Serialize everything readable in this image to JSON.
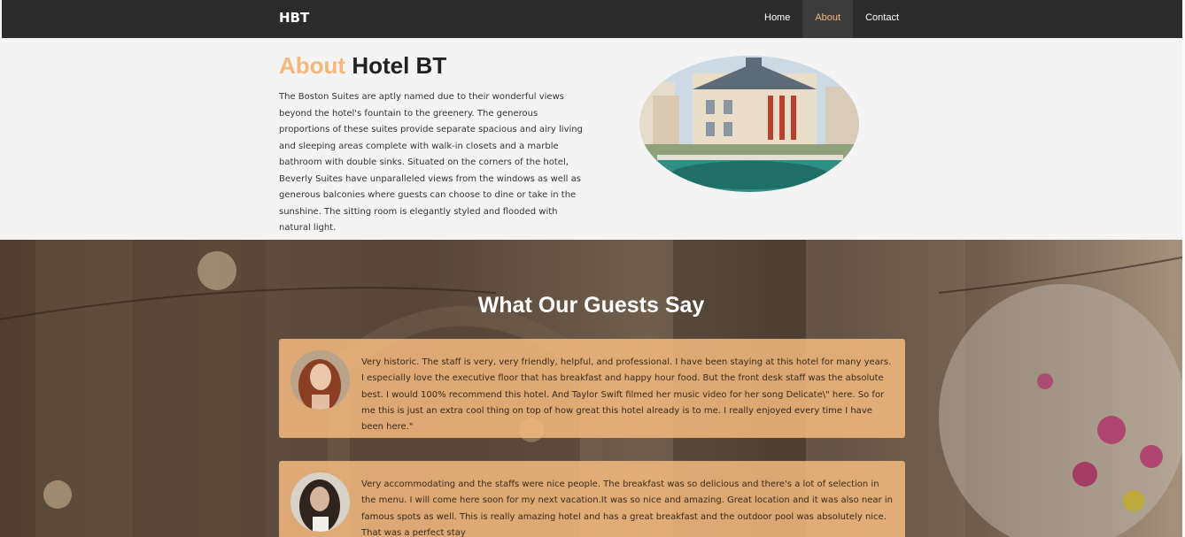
{
  "nav": {
    "brand": "HBT",
    "links": [
      "Home",
      "About",
      "Contact"
    ],
    "active": "About",
    "accent_color": "#f4b77e"
  },
  "about": {
    "title_accent": "About",
    "title_rest": "Hotel BT",
    "body": "The Boston Suites are aptly named due to their wonderful views beyond the hotel's fountain to the greenery. The generous proportions of these suites provide separate spacious and airy living and sleeping areas complete with walk-in closets and a marble bathroom with double sinks. Situated on the corners of the hotel, Beverly Suites have unparalleled views from the windows as well as generous balconies where guests can choose to dine or take in the sunshine. The sitting room is elegantly styled and flooded with natural light."
  },
  "guests": {
    "heading": "What Our Guests Say",
    "testimonials": [
      {
        "text": "Very historic. The staff is very, very friendly, helpful, and professional. I have been staying at this hotel for many years. I especially love the executive floor that has breakfast and happy hour food. But the front desk staff was the absolute best. I would 100% recommend this hotel. And Taylor Swift filmed her music video for her song Delicate\\\" here. So for me this is just an extra cool thing on top of how great this hotel already is to me. I really enjoyed every time I have been here.\""
      },
      {
        "text": "Very accommodating and the staffs were nice people. The breakfast was so delicious and there's a lot of selection in the menu. I will come here soon for my next vacation.It was so nice and amazing. Great location and it was also near in famous spots as well. This is really amazing hotel and has a great breakfast and the outdoor pool was absolutely nice. That was a perfect stay"
      }
    ]
  }
}
